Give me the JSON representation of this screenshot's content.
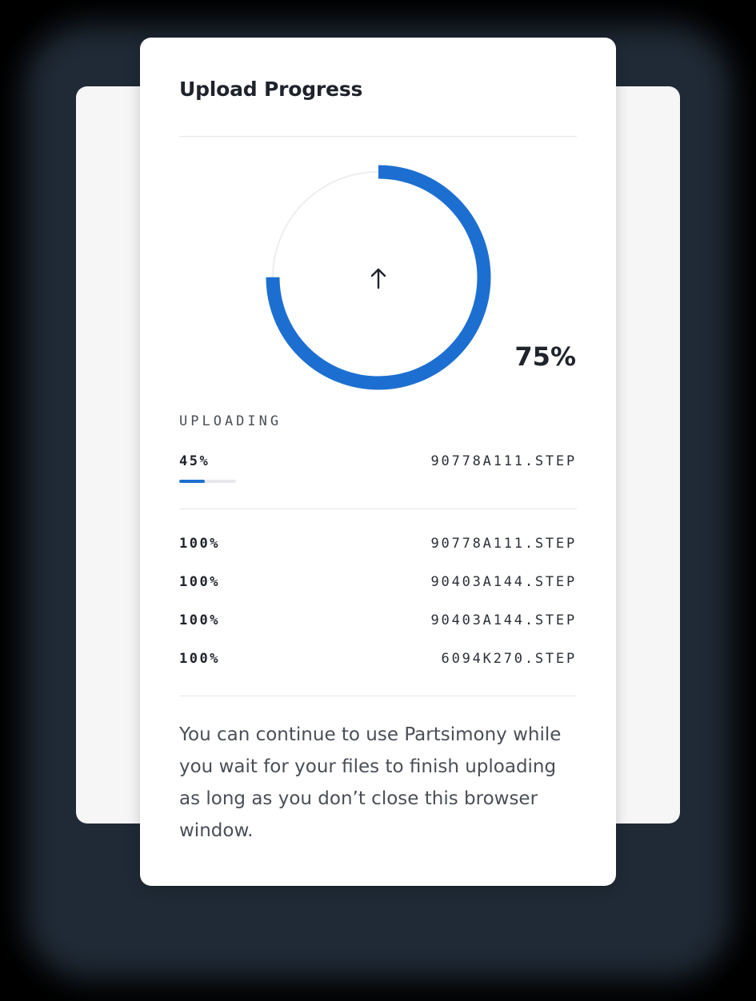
{
  "panel": {
    "title": "Upload Progress",
    "overall_percent_label": "75%",
    "overall_progress": 0.75,
    "upload_icon": "arrow-up-icon",
    "accent_color": "#1c6fd1",
    "track_color": "#eceef1"
  },
  "current": {
    "section_label": "UPLOADING",
    "percent_label": "45%",
    "progress": 0.45,
    "filename": "90778A111.STEP"
  },
  "completed": [
    {
      "percent_label": "100%",
      "filename": "90778A111.STEP"
    },
    {
      "percent_label": "100%",
      "filename": "90403A144.STEP"
    },
    {
      "percent_label": "100%",
      "filename": "90403A144.STEP"
    },
    {
      "percent_label": "100%",
      "filename": "6094K270.STEP"
    }
  ],
  "footer": {
    "note": "You can continue to use Partsimony while you wait for your files to finish uploading as long as you don’t close this browser window."
  }
}
